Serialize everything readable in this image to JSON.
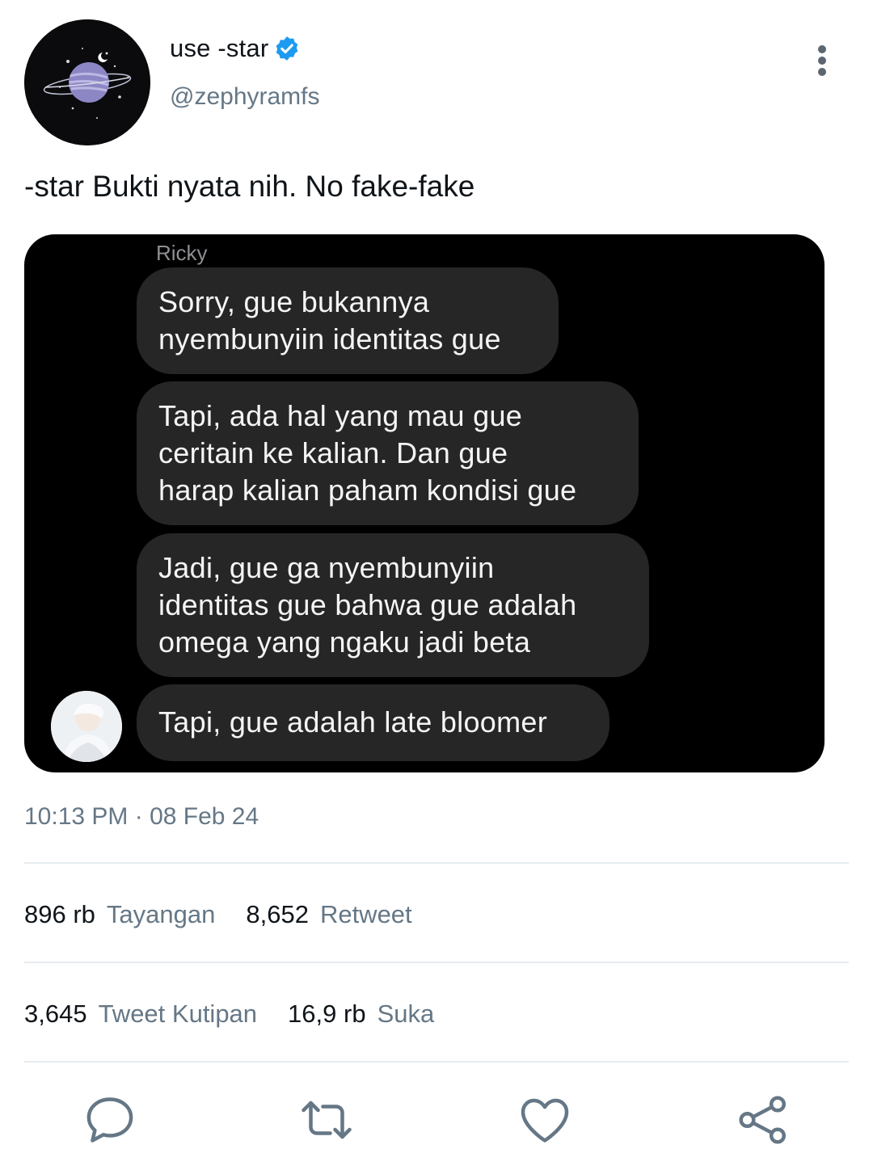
{
  "profile": {
    "display_name": "use -star",
    "handle": "@zephyramfs",
    "avatar_icon": "planet-avatar",
    "verified_icon": "verified-badge-icon",
    "verified_color": "#1d9bf0"
  },
  "tweet": {
    "text": "-star Bukti nyata nih. No fake-fake",
    "timestamp": "10:13 PM · 08 Feb 24"
  },
  "media": {
    "sender_name": "Ricky",
    "messages": [
      {
        "lines": [
          "Sorry, gue bukannya",
          "nyembunyiin identitas gue"
        ]
      },
      {
        "lines": [
          "Tapi, ada hal yang mau gue",
          "ceritain ke kalian. Dan gue",
          "harap kalian paham kondisi gue"
        ]
      },
      {
        "lines": [
          "Jadi, gue ga nyembunyiin",
          "identitas gue bahwa gue adalah",
          "omega yang ngaku jadi beta"
        ]
      },
      {
        "lines": [
          "Tapi, gue adalah late bloomer"
        ]
      }
    ]
  },
  "stats": {
    "views_count": "896 rb",
    "views_label": "Tayangan",
    "retweets_count": "8,652",
    "retweets_label": "Retweet",
    "quotes_count": "3,645",
    "quotes_label": "Tweet Kutipan",
    "likes_count": "16,9 rb",
    "likes_label": "Suka"
  },
  "actions": [
    "reply-icon",
    "retweet-icon",
    "like-icon",
    "share-icon"
  ],
  "colors": {
    "icon_gray": "#657786",
    "bubble": "#262626",
    "text_primary": "#0f1419"
  }
}
